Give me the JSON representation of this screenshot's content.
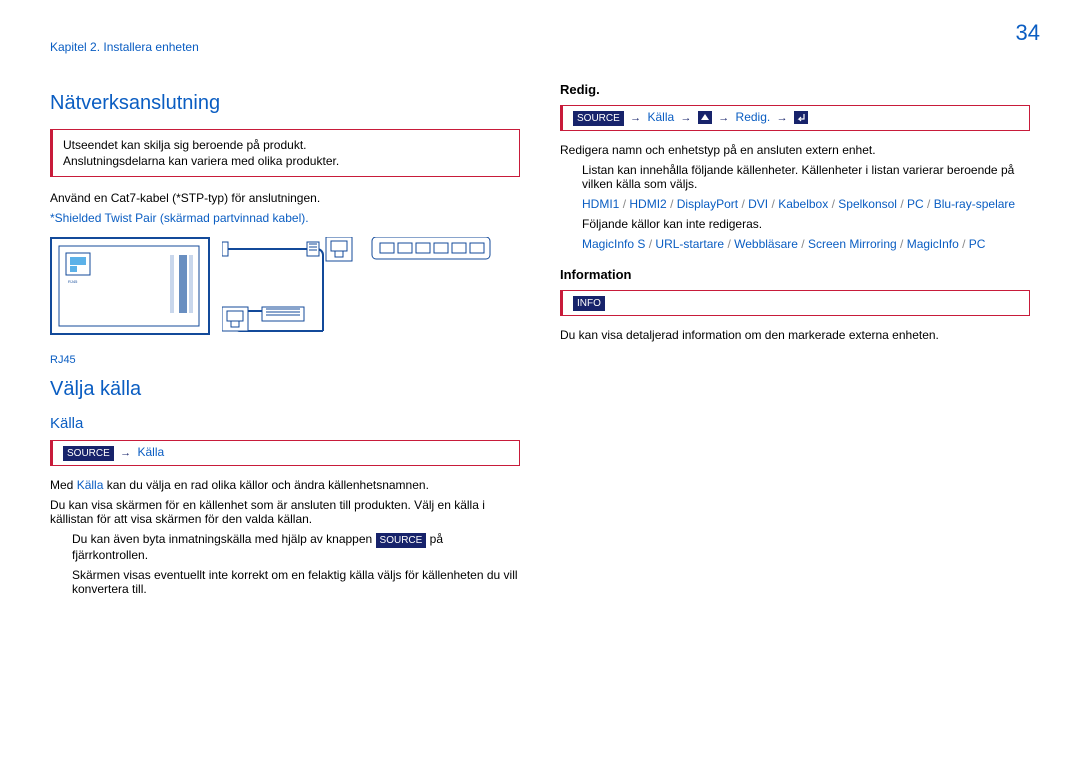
{
  "page_number": "34",
  "chapter": "Kapitel 2. Installera enheten",
  "left": {
    "section1_title": "Nätverksanslutning",
    "callout_line1": "Utseendet kan skilja sig beroende på produkt.",
    "callout_line2": "Anslutningsdelarna kan variera med olika produkter.",
    "cable_line": "Använd en Cat7-kabel (*STP-typ) för anslutningen.",
    "cable_note": "*Shielded Twist Pair (skärmad partvinnad kabel).",
    "rj45_label": "RJ45",
    "section2_title": "Välja källa",
    "section2_subtitle": "Källa",
    "notebox_source": "SOURCE",
    "notebox_sourcelabel": "Källa",
    "body1_pre": "Med ",
    "body1_accent": "Källa",
    "body1_post": " kan du välja en rad olika källor och ändra källenhetsnamnen.",
    "body2": "Du kan visa skärmen för en källenhet som är ansluten till produkten. Välj en källa i källistan för att visa skärmen för den valda källan.",
    "indent1_pre": "Du kan även byta inmatningskälla med hjälp av knappen ",
    "indent1_key": "SOURCE",
    "indent1_post": " på fjärrkontrollen.",
    "indent2": "Skärmen visas eventuellt inte korrekt om en felaktig källa väljs för källenheten du vill konvertera till."
  },
  "right": {
    "redig_title": "Redig.",
    "redig_notebox_source": "SOURCE",
    "redig_notebox_kalla": "Källa",
    "redig_notebox_redig": "Redig.",
    "redig_body1": "Redigera namn och enhetstyp på en ansluten extern enhet.",
    "redig_body2": "Listan kan innehålla följande källenheter. Källenheter i listan varierar beroende på vilken källa som väljs.",
    "sources1": [
      "HDMI1",
      "HDMI2",
      "DisplayPort",
      "DVI",
      "Kabelbox",
      "Spelkonsol",
      "PC",
      "Blu-ray-spelare"
    ],
    "redig_body3": "Följande källor kan inte redigeras.",
    "sources2": [
      "MagicInfo S",
      "URL-startare",
      "Webbläsare",
      "Screen Mirroring",
      "MagicInfo",
      "PC"
    ],
    "info_title": "Information",
    "info_notebox": "INFO",
    "info_body": "Du kan visa detaljerad information om den markerade externa enheten."
  }
}
